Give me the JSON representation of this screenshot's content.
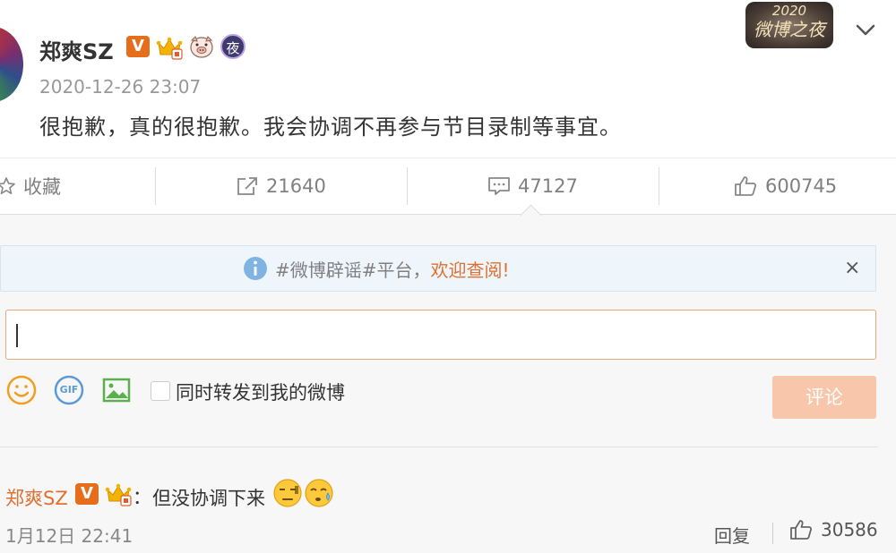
{
  "post": {
    "username": "郑爽SZ",
    "verified_mark": "V",
    "night_badge": "夜",
    "event_badge": {
      "year": "2020",
      "name": "微博之夜"
    },
    "timestamp": "2020-12-26 23:07",
    "text": "很抱歉，真的很抱歉。我会协调不再参与节目录制等事宜。"
  },
  "actions": {
    "favorite_label": "收藏",
    "repost_count": "21640",
    "comment_count": "47127",
    "like_count": "600745"
  },
  "notice": {
    "text": "#微博辟谣#平台，",
    "link": "欢迎查阅!",
    "close_glyph": "×"
  },
  "composer": {
    "input_value": "",
    "repost_checkbox_label": "同时转发到我的微博",
    "repost_checked": false,
    "submit_label": "评论",
    "gif_label": "GIF"
  },
  "comments": [
    {
      "username": "郑爽SZ",
      "verified_mark": "V",
      "colon": "：",
      "text": "但没协调下来",
      "emojis": [
        "awkward-face-icon",
        "sweat-face-icon"
      ],
      "time": "1月12日 22:41",
      "reply_label": "回复",
      "like_count": "30586"
    }
  ],
  "colors": {
    "accent_orange": "#e07030",
    "verified_orange": "#e66e1a",
    "submit_disabled": "#f7c6ab",
    "input_border": "#e8a87c",
    "notice_bg": "#eef5fb"
  }
}
